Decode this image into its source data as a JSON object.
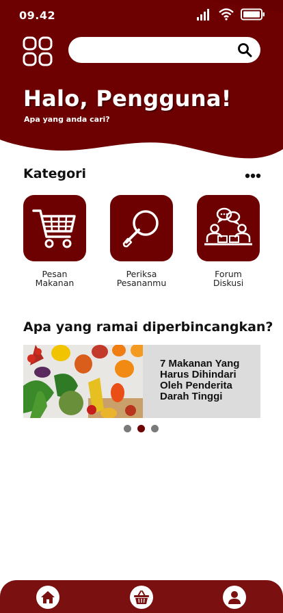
{
  "status_bar": {
    "time": "09.42"
  },
  "search": {
    "placeholder": ""
  },
  "greeting": {
    "title": "Halo, Pengguna!",
    "subtitle": "Apa yang anda cari?"
  },
  "categories": {
    "title": "Kategori",
    "items": [
      {
        "label": "Pesan\nMakanan",
        "icon": "shopping-cart-icon"
      },
      {
        "label": "Periksa\nPesananmu",
        "icon": "magnifier-icon"
      },
      {
        "label": "Forum\nDiskusi",
        "icon": "discussion-icon"
      }
    ]
  },
  "trending": {
    "title": "Apa yang ramai diperbincangkan?",
    "banner": {
      "text": "7 Makanan Yang Harus Dihindari Oleh Penderita Darah Tinggi"
    },
    "active_slide": 2,
    "slide_count": 3
  },
  "bottom_nav": {
    "items": [
      "home-icon",
      "basket-icon",
      "profile-icon"
    ]
  },
  "colors": {
    "primary": "#6d0000",
    "nav": "#7a1010"
  }
}
